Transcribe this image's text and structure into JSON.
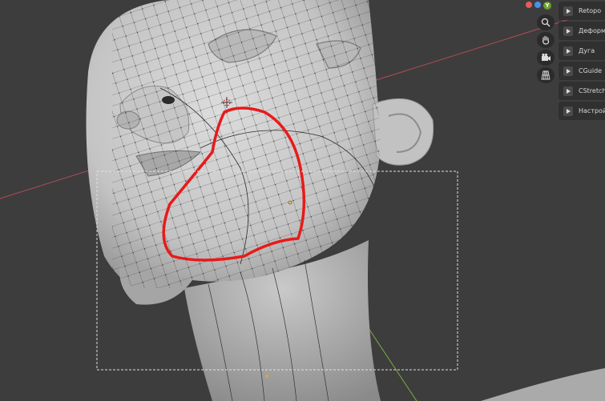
{
  "gizmo": {
    "x_color": "#e55b5b",
    "z_color": "#4b8ff0",
    "y_color": "#6aa12a",
    "y_label": "Y"
  },
  "navigation_tools": [
    {
      "icon": "zoom-icon"
    },
    {
      "icon": "hand-pan-icon"
    },
    {
      "icon": "camera-icon"
    },
    {
      "icon": "grid-perspective-icon"
    }
  ],
  "panel_tabs": [
    {
      "label": "Retopo"
    },
    {
      "label": "Деформа"
    },
    {
      "label": "Дуга"
    },
    {
      "label": "CGuide"
    },
    {
      "label": "CStretch"
    },
    {
      "label": "Настройк"
    }
  ],
  "colors": {
    "viewport_bg": "#3d3d3d",
    "mesh": "#cfcfcf",
    "annotation": "#e81a1a",
    "x_axis": "#b34b57",
    "y_axis": "#7fae3d",
    "selection_box": "#e0e0e0"
  }
}
